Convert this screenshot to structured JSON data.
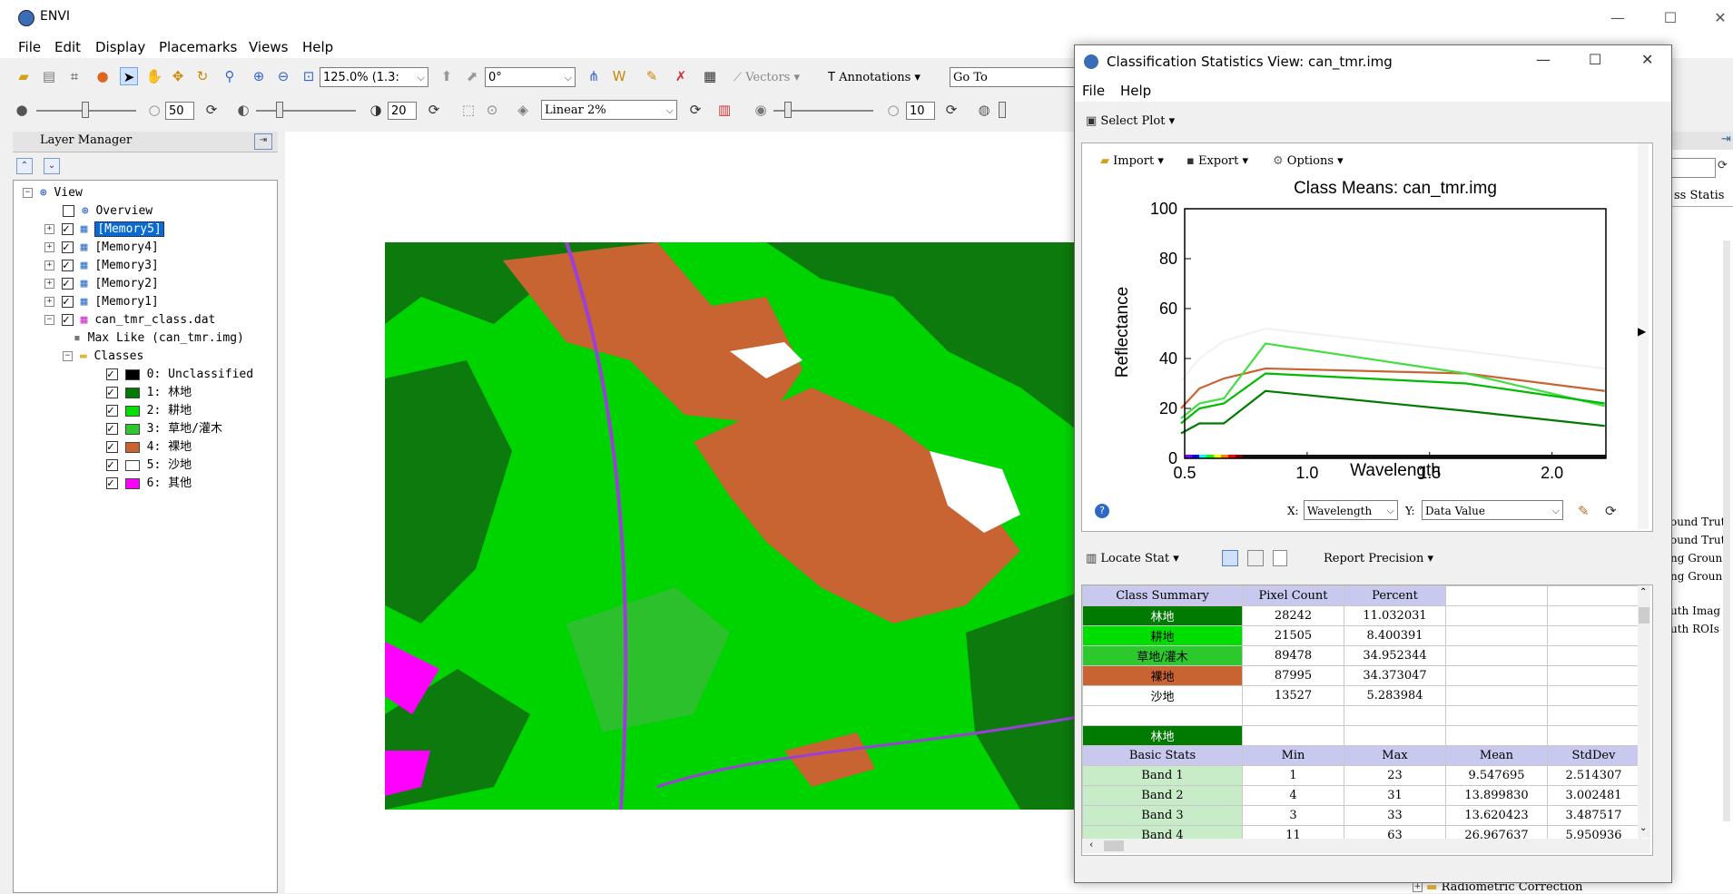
{
  "app": {
    "title": "ENVI"
  },
  "menu": [
    "File",
    "Edit",
    "Display",
    "Placemarks",
    "Views",
    "Help"
  ],
  "toolbar": {
    "zoom_value": "125.0% (1.3:",
    "rotation_value": "0°",
    "vectors_label": "Vectors",
    "annotations_label": "Annotations",
    "goto_value": "Go To",
    "brightness_value": "50",
    "contrast_value": "20",
    "stretch_value": "Linear 2%",
    "transparency_value": "10"
  },
  "layer_manager": {
    "title": "Layer Manager",
    "items": [
      {
        "label": "View"
      },
      {
        "label": "Overview"
      },
      {
        "label": "[Memory5]"
      },
      {
        "label": "[Memory4]"
      },
      {
        "label": "[Memory3]"
      },
      {
        "label": "[Memory2]"
      },
      {
        "label": "[Memory1]"
      },
      {
        "label": "can_tmr_class.dat"
      },
      {
        "label": "Max Like (can_tmr.img)"
      },
      {
        "label": "Classes"
      }
    ],
    "classes": [
      {
        "label": "0: Unclassified",
        "color": "#000000"
      },
      {
        "label": "1: 林地",
        "color": "#007a00"
      },
      {
        "label": "2: 耕地",
        "color": "#00e000"
      },
      {
        "label": "3: 草地/灌木",
        "color": "#2dc82d"
      },
      {
        "label": "4: 裸地",
        "color": "#c86432"
      },
      {
        "label": "5: 沙地",
        "color": "#ffffff"
      },
      {
        "label": "6: 其他",
        "color": "#ff00ff"
      }
    ]
  },
  "dialog": {
    "title": "Classification Statistics View: can_tmr.img",
    "menu": [
      "File",
      "Help"
    ],
    "select_plot": "Select Plot",
    "plot_toolbar": [
      "Import",
      "Export",
      "Options"
    ],
    "x_label": "X:",
    "x_value": "Wavelength",
    "y_label": "Y:",
    "y_value": "Data Value",
    "locate_stat": "Locate Stat",
    "report_precision": "Report Precision",
    "summary_headers": [
      "Class Summary",
      "Pixel Count",
      "Percent"
    ],
    "summary_rows": [
      {
        "name": "林地",
        "count": "28242",
        "percent": "11.032031",
        "color": "#007a00",
        "text": "#ffffff"
      },
      {
        "name": "耕地",
        "count": "21505",
        "percent": "8.400391",
        "color": "#00dd00",
        "text": "#000000"
      },
      {
        "name": "草地/灌木",
        "count": "89478",
        "percent": "34.952344",
        "color": "#2dc82d",
        "text": "#000000"
      },
      {
        "name": "裸地",
        "count": "87995",
        "percent": "34.373047",
        "color": "#c86432",
        "text": "#000000"
      },
      {
        "name": "沙地",
        "count": "13527",
        "percent": "5.283984",
        "color": "#ffffff",
        "text": "#000000"
      }
    ],
    "class_label": "林地",
    "basic_headers": [
      "Basic Stats",
      "Min",
      "Max",
      "Mean",
      "StdDev"
    ],
    "basic_rows": [
      [
        "Band 1",
        "1",
        "23",
        "9.547695",
        "2.514307"
      ],
      [
        "Band 2",
        "4",
        "31",
        "13.899830",
        "3.002481"
      ],
      [
        "Band 3",
        "3",
        "33",
        "13.620423",
        "3.487517"
      ],
      [
        "Band 4",
        "11",
        "63",
        "26.967637",
        "5.950936"
      ]
    ]
  },
  "right_panel": {
    "tab_label": "ss Statis",
    "lines": [
      "ound Trut",
      "ound Trut",
      "ng Groun",
      "ng Groun",
      "uth Imag",
      "uth ROIs"
    ],
    "bottom_label": "Radiometric Correction"
  },
  "chart_data": {
    "type": "line",
    "title": "Class Means: can_tmr.img",
    "xlabel": "Wavelength",
    "ylabel": "Reflectance",
    "xlim": [
      0.5,
      2.22
    ],
    "ylim": [
      0,
      100
    ],
    "xticks": [
      "0.5",
      "1.0",
      "1.5",
      "2.0"
    ],
    "yticks": [
      "0",
      "20",
      "40",
      "60",
      "80",
      "100"
    ],
    "x": [
      0.485,
      0.56,
      0.66,
      0.83,
      1.65,
      2.215
    ],
    "series": [
      {
        "color": "#f2f2f2",
        "values": [
          31,
          40,
          47,
          52,
          43,
          36
        ]
      },
      {
        "color": "#c86432",
        "values": [
          20,
          28,
          32,
          36,
          34,
          27
        ]
      },
      {
        "color": "#44dd44",
        "values": [
          16,
          22,
          24,
          46,
          34,
          21
        ]
      },
      {
        "color": "#00bb00",
        "values": [
          14,
          20,
          22,
          34,
          30,
          22
        ]
      },
      {
        "color": "#007a00",
        "values": [
          10,
          14,
          14,
          27,
          19,
          13
        ]
      }
    ]
  }
}
